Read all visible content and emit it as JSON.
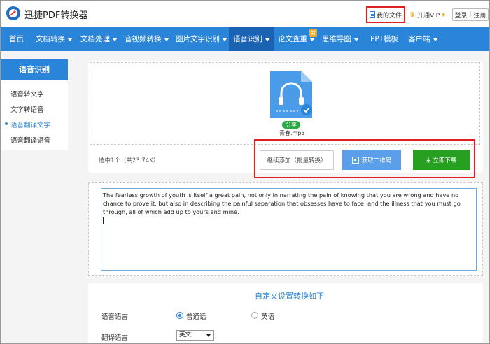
{
  "header": {
    "app_title": "迅捷PDF转换器",
    "my_files": "我的文件",
    "vip": "开通VIP",
    "login": "登录",
    "register": "注册"
  },
  "nav": {
    "items": [
      {
        "label": "首页"
      },
      {
        "label": "文档转换"
      },
      {
        "label": "文档处理"
      },
      {
        "label": "音视频转换"
      },
      {
        "label": "图片文字识别"
      },
      {
        "label": "语音识别"
      },
      {
        "label": "论文查重"
      },
      {
        "label": "思维导图"
      },
      {
        "label": "PPT模板"
      },
      {
        "label": "客户端"
      }
    ],
    "new_badge": "新",
    "active_color": "#1a63b3",
    "bar_color": "#2a85d8"
  },
  "sidebar": {
    "title": "语音识别",
    "items": [
      {
        "label": "语音转文字"
      },
      {
        "label": "文字转语音"
      },
      {
        "label": "语音翻译文字"
      },
      {
        "label": "语音翻译语音"
      }
    ]
  },
  "upload": {
    "share_label": "分享",
    "file_name": "青春.mp3",
    "selected_info": "选中1个（共23.74K）",
    "continue_button": "继续添加（批量转换）",
    "qr_button": "获取二维码",
    "download_button": "立即下载"
  },
  "text_result": {
    "content": "The fearless growth of youth is itself a great pain, not only in narrating the pain of knowing that you are wrong and have no chance to prove it, but also in describing the painful separation that obsesses have to face, and the illness that you must go through, all of which add up to yours and mine."
  },
  "settings": {
    "title": "自定义设置转换如下",
    "speech_language_label": "语音语言",
    "speech_options": [
      {
        "label": "普通话",
        "checked": true
      },
      {
        "label": "英语",
        "checked": false
      }
    ],
    "translate_language_label": "翻译语言",
    "translate_selected": "英文"
  },
  "colors": {
    "accent": "#2a85d8",
    "download_green": "#27a021",
    "highlight_red": "#e02020"
  }
}
